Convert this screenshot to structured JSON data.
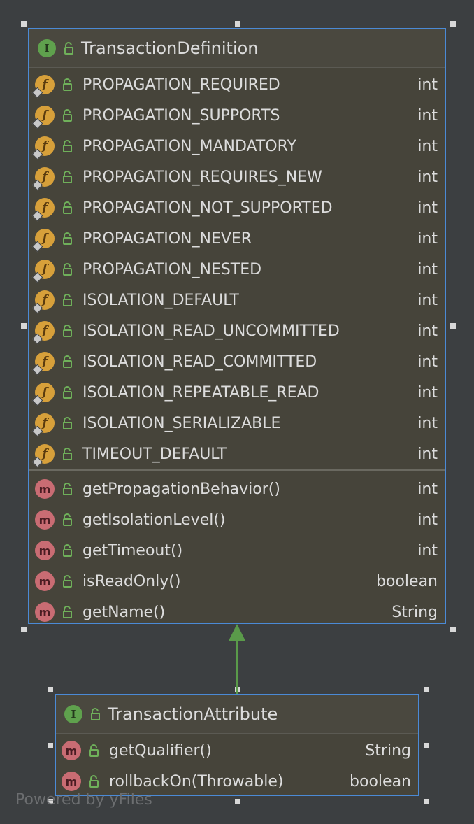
{
  "diagram": {
    "interface_badge": "I",
    "field_badge": "f",
    "method_badge": "m",
    "accent_border": "#4b8ad6",
    "edge_color": "#5a9a4a",
    "transaction_definition": {
      "title": "TransactionDefinition",
      "fields": [
        {
          "name": "PROPAGATION_REQUIRED",
          "type": "int"
        },
        {
          "name": "PROPAGATION_SUPPORTS",
          "type": "int"
        },
        {
          "name": "PROPAGATION_MANDATORY",
          "type": "int"
        },
        {
          "name": "PROPAGATION_REQUIRES_NEW",
          "type": "int"
        },
        {
          "name": "PROPAGATION_NOT_SUPPORTED",
          "type": "int"
        },
        {
          "name": "PROPAGATION_NEVER",
          "type": "int"
        },
        {
          "name": "PROPAGATION_NESTED",
          "type": "int"
        },
        {
          "name": "ISOLATION_DEFAULT",
          "type": "int"
        },
        {
          "name": "ISOLATION_READ_UNCOMMITTED",
          "type": "int"
        },
        {
          "name": "ISOLATION_READ_COMMITTED",
          "type": "int"
        },
        {
          "name": "ISOLATION_REPEATABLE_READ",
          "type": "int"
        },
        {
          "name": "ISOLATION_SERIALIZABLE",
          "type": "int"
        },
        {
          "name": "TIMEOUT_DEFAULT",
          "type": "int"
        }
      ],
      "methods": [
        {
          "name": "getPropagationBehavior()",
          "type": "int"
        },
        {
          "name": "getIsolationLevel()",
          "type": "int"
        },
        {
          "name": "getTimeout()",
          "type": "int"
        },
        {
          "name": "isReadOnly()",
          "type": "boolean"
        },
        {
          "name": "getName()",
          "type": "String"
        }
      ]
    },
    "transaction_attribute": {
      "title": "TransactionAttribute",
      "methods": [
        {
          "name": "getQualifier()",
          "type": "String"
        },
        {
          "name": "rollbackOn(Throwable)",
          "type": "boolean"
        }
      ]
    },
    "watermark": "Powered by yFiles"
  }
}
